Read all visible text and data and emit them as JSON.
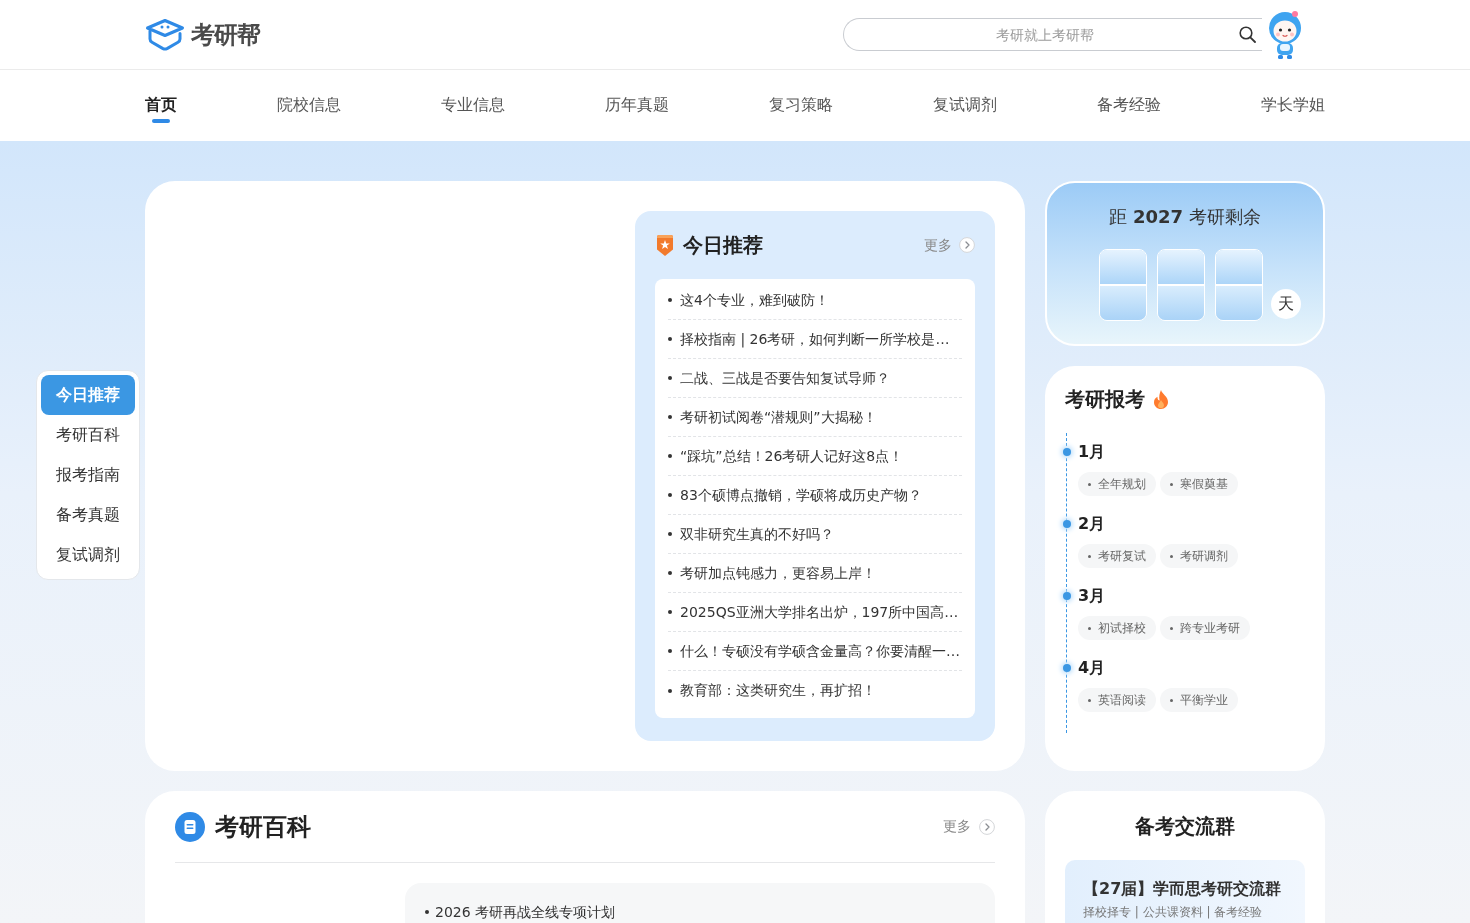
{
  "header": {
    "logo": "考研帮",
    "search": {
      "placeholder": "考研就上考研帮"
    }
  },
  "nav": [
    {
      "label": "首页",
      "selected": true
    },
    {
      "label": "院校信息",
      "selected": false
    },
    {
      "label": "专业信息",
      "selected": false
    },
    {
      "label": "历年真题",
      "selected": false
    },
    {
      "label": "复习策略",
      "selected": false
    },
    {
      "label": "复试调剂",
      "selected": false
    },
    {
      "label": "备考经验",
      "selected": false
    },
    {
      "label": "学长学姐",
      "selected": false
    }
  ],
  "side_nav": [
    {
      "label": "今日推荐",
      "selected": true
    },
    {
      "label": "考研百科",
      "selected": false
    },
    {
      "label": "报考指南",
      "selected": false
    },
    {
      "label": "备考真题",
      "selected": false
    },
    {
      "label": "复试调剂",
      "selected": false
    }
  ],
  "recommend": {
    "title": "今日推荐",
    "more": "更多",
    "items": [
      "这4个专业，难到破防！",
      "择校指南 | 26考研，如何判断一所学校是…",
      "二战、三战是否要告知复试导师？",
      "考研初试阅卷“潜规则”大揭秘！",
      "“踩坑”总结！26考研人记好这8点！",
      "83个硕博点撤销，学硕将成历史产物？",
      "双非研究生真的不好吗？",
      "考研加点钝感力，更容易上岸！",
      "2025QS亚洲大学排名出炉，197所中国高…",
      "什么！专硕没有学硕含金量高？你要清醒一…",
      "教育部：这类研究生，再扩招！"
    ]
  },
  "countdown": {
    "title": "距 **2027** 考研剩余",
    "unit": "天"
  },
  "exam": {
    "title": "考研报考",
    "months": [
      {
        "label": "1月",
        "tags": [
          "全年规划",
          "寒假奠基"
        ]
      },
      {
        "label": "2月",
        "tags": [
          "考研复试",
          "考研调剂"
        ]
      },
      {
        "label": "3月",
        "tags": [
          "初试择校",
          "跨专业考研"
        ]
      },
      {
        "label": "4月",
        "tags": [
          "英语阅读",
          "平衡学业"
        ]
      }
    ]
  },
  "wiki": {
    "title": "考研百科",
    "more": "更多",
    "items": [
      "2026 考研再战全线专项计划"
    ]
  },
  "group": {
    "title": "备考交流群",
    "cards": [
      {
        "name": "【27届】学而思考研交流群",
        "tags": "择校择专 | 公共课资料 | 备考经验"
      }
    ]
  }
}
